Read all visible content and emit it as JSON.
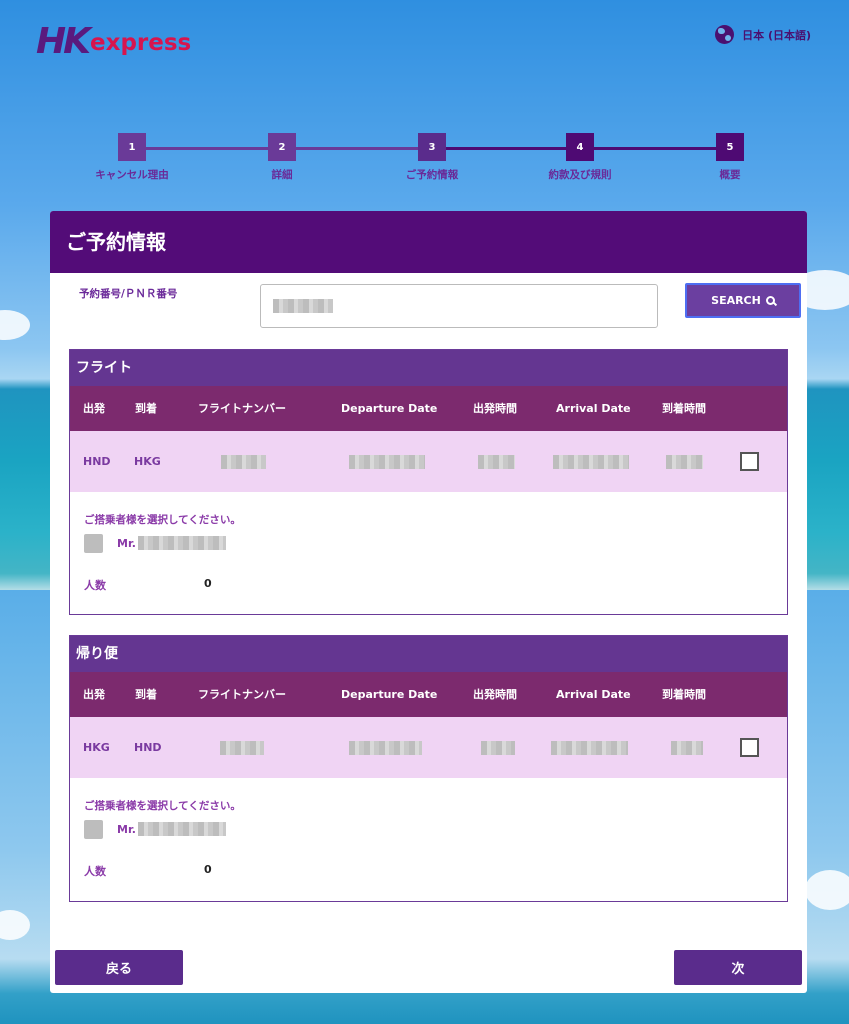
{
  "header": {
    "logo_hk": "HK",
    "logo_express": "express",
    "language": "日本 (日本語)"
  },
  "steps": [
    {
      "number": "1",
      "label": "キャンセル理由",
      "state": "done"
    },
    {
      "number": "2",
      "label": "詳細",
      "state": "done"
    },
    {
      "number": "3",
      "label": "ご予約情報",
      "state": "active"
    },
    {
      "number": "4",
      "label": "約款及び規則",
      "state": "pending"
    },
    {
      "number": "5",
      "label": "概要",
      "state": "pending"
    }
  ],
  "colors": {
    "step_done": "#6a3a98",
    "step_active": "#5a2c8c",
    "step_pending": "#4e0a73",
    "brand_purple": "#530c78",
    "brand_red": "#d7154e"
  },
  "page_title": "ご予約情報",
  "pnr": {
    "label": "予約番号/ＰＮＲ番号",
    "search_label": "SEARCH"
  },
  "columns": {
    "origin": "出発",
    "destination": "到着",
    "flight_number": "フライトナンバー",
    "departure_date": "Departure Date",
    "departure_time": "出発時間",
    "arrival_date": "Arrival Date",
    "arrival_time": "到着時間"
  },
  "outbound": {
    "title": "フライト",
    "origin": "HND",
    "destination": "HKG",
    "pax_prompt": "ご搭乗者様を選択してください。",
    "pax_title": "Mr.",
    "count_label": "人数",
    "count_value": "0"
  },
  "return": {
    "title": "帰り便",
    "origin": "HKG",
    "destination": "HND",
    "pax_prompt": "ご搭乗者様を選択してください。",
    "pax_title": "Mr.",
    "count_label": "人数",
    "count_value": "0"
  },
  "nav": {
    "back_label": "戻る",
    "next_label": "次"
  }
}
